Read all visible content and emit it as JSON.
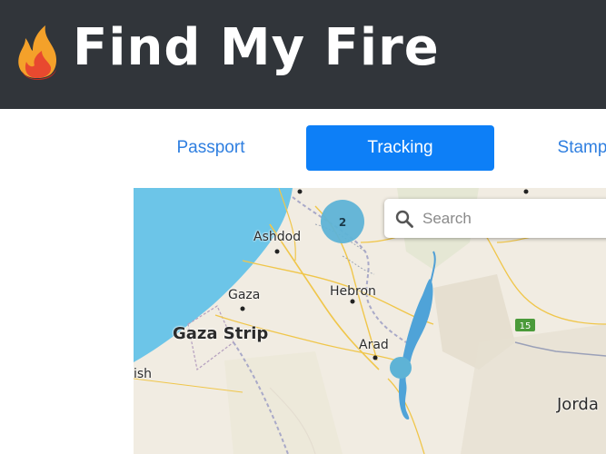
{
  "app": {
    "title": "Find My Fire"
  },
  "tabs": [
    {
      "label": "Passport",
      "active": false
    },
    {
      "label": "Tracking",
      "active": true
    },
    {
      "label": "Stamp",
      "active": false
    }
  ],
  "search": {
    "placeholder": "Search"
  },
  "map": {
    "cluster_count": "2",
    "places": {
      "ashdod": "Ashdod",
      "gaza": "Gaza",
      "gaza_strip": "Gaza Strip",
      "hebron": "Hebron",
      "arad": "Arad",
      "jordan": "Jorda",
      "partial": "ish"
    },
    "road_shield": "15"
  },
  "colors": {
    "header_bg": "#31353a",
    "tab_active_bg": "#0d7ff7",
    "tab_text": "#2f7fe0",
    "sea": "#6cc5e8",
    "cluster": "#5eb3d6",
    "land": "#f1ece2"
  }
}
